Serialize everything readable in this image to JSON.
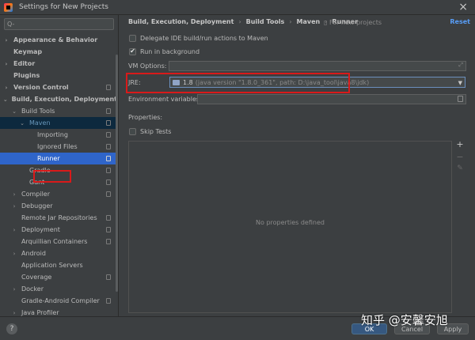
{
  "window": {
    "title": "Settings for New Projects"
  },
  "search": {
    "placeholder": "Q-"
  },
  "sidebar": {
    "items": [
      {
        "label": "Appearance & Behavior",
        "arrow": "›",
        "bold": true
      },
      {
        "label": "Keymap",
        "bold": true
      },
      {
        "label": "Editor",
        "arrow": "›",
        "bold": true
      },
      {
        "label": "Plugins",
        "bold": true
      },
      {
        "label": "Version Control",
        "arrow": "›",
        "bold": true
      },
      {
        "label": "Build, Execution, Deployment",
        "arrow": "⌄",
        "bold": true
      },
      {
        "label": "Build Tools",
        "arrow": "⌄"
      },
      {
        "label": "Maven",
        "arrow": "⌄"
      },
      {
        "label": "Importing"
      },
      {
        "label": "Ignored Files"
      },
      {
        "label": "Runner"
      },
      {
        "label": "Gradle"
      },
      {
        "label": "Gant"
      },
      {
        "label": "Compiler",
        "arrow": "›"
      },
      {
        "label": "Debugger",
        "arrow": "›"
      },
      {
        "label": "Remote Jar Repositories"
      },
      {
        "label": "Deployment",
        "arrow": "›"
      },
      {
        "label": "Arquillian Containers"
      },
      {
        "label": "Android",
        "arrow": "›"
      },
      {
        "label": "Application Servers"
      },
      {
        "label": "Coverage"
      },
      {
        "label": "Docker",
        "arrow": "›"
      },
      {
        "label": "Gradle-Android Compiler"
      },
      {
        "label": "Java Profiler",
        "arrow": "›"
      }
    ]
  },
  "breadcrumb": {
    "items": [
      "Build, Execution, Deployment",
      "Build Tools",
      "Maven",
      "Runner"
    ],
    "separator": "›",
    "for_new_projects": "For new projects",
    "reset": "Reset"
  },
  "runner": {
    "delegate_label": "Delegate IDE build/run actions to Maven",
    "delegate_checked": false,
    "background_label": "Run in background",
    "background_checked": true,
    "vm_options_label": "VM Options:",
    "vm_options_value": "",
    "jre_label": "JRE:",
    "jre_value": "1.8",
    "jre_detail": "(java version \"1.8.0_361\", path: D:\\java_tool\\java8\\jdk)",
    "env_label": "Environment variables:",
    "env_value": "",
    "properties_label": "Properties:",
    "skip_tests_label": "Skip Tests",
    "skip_tests_checked": false,
    "no_properties": "No properties defined"
  },
  "tools": {
    "add": "+",
    "remove": "−",
    "edit": "✎"
  },
  "buttons": {
    "help": "?",
    "ok": "OK",
    "cancel": "Cancel",
    "apply": "Apply"
  },
  "watermark": "知乎 @安馨安旭",
  "colors": {
    "accent": "#2f65ca",
    "highlight_border": "#d91a1a",
    "link": "#589df6",
    "background": "#3c3f41"
  }
}
